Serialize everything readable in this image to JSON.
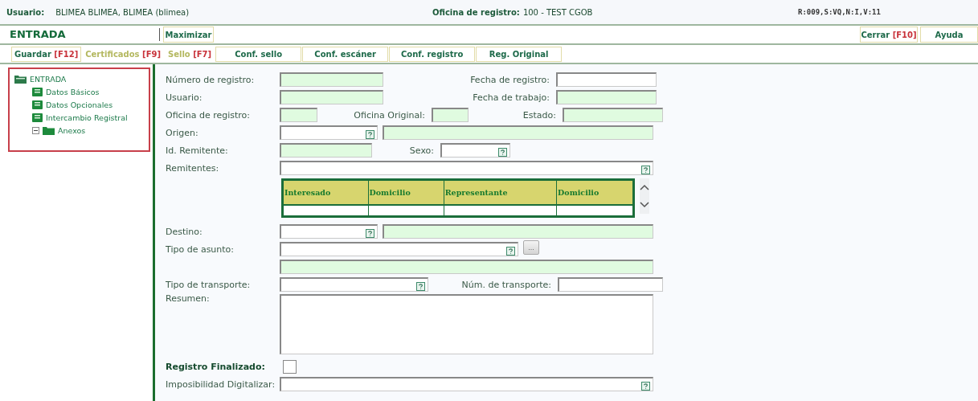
{
  "header": {
    "user_label": "Usuario:",
    "user": "BLIMEA BLIMEA, BLIMEA (blimea)",
    "office_label": "Oficina de registro:",
    "office": "100 - TEST CGOB",
    "version": "R:009,S:VQ,N:I,V:11"
  },
  "title": "ENTRADA",
  "maximize_button": "Maximizar",
  "right_buttons": [
    {
      "label": "Cerrar",
      "key": "[F10]"
    },
    {
      "label": "Ayuda"
    }
  ],
  "action_buttons": [
    {
      "label": "Guardar",
      "key": "[F12]",
      "disabled": false
    },
    {
      "label": "Certificados",
      "key": "[F9]",
      "disabled": true
    },
    {
      "label": "Sello",
      "key": "[F7]",
      "disabled": true
    },
    {
      "label": "Conf. sello",
      "disabled": false
    },
    {
      "label": "Conf. escáner",
      "disabled": false
    },
    {
      "label": "Conf. registro",
      "disabled": false
    },
    {
      "label": "Reg. Original",
      "disabled": false
    }
  ],
  "tree": {
    "label": "ENTRADA",
    "children": [
      {
        "label": "Datos Básicos"
      },
      {
        "label": "Datos Opcionales"
      },
      {
        "label": "Intercambio Registral"
      },
      {
        "label": "Anexos",
        "expanded": true
      }
    ]
  },
  "form_rows": [
    {
      "label": "Número de registro:",
      "items": [
        {
          "kind": "input",
          "readonly": true
        },
        {
          "kind": "label",
          "text": "Fecha de registro:"
        },
        {
          "kind": "input",
          "readonly": false
        }
      ]
    },
    {
      "label": "Usuario:",
      "items": [
        {
          "kind": "input",
          "readonly": true
        },
        {
          "kind": "label",
          "text": "Fecha de trabajo:"
        },
        {
          "kind": "input",
          "readonly": true
        }
      ]
    },
    {
      "label": "Oficina de registro:",
      "items": [
        {
          "kind": "input",
          "readonly": true
        },
        {
          "kind": "label",
          "text": "Oficina Original:"
        },
        {
          "kind": "input",
          "readonly": true
        },
        {
          "kind": "label",
          "text": "Estado:"
        },
        {
          "kind": "input",
          "readonly": true
        }
      ]
    },
    {
      "label": "Origen:",
      "items": [
        {
          "kind": "lookup",
          "readonly": false
        },
        {
          "kind": "input",
          "readonly": true
        }
      ]
    },
    {
      "label": "Id. Remitente:",
      "items": [
        {
          "kind": "input",
          "readonly": true
        },
        {
          "kind": "label",
          "text": "Sexo:"
        },
        {
          "kind": "lookup",
          "readonly": false
        }
      ]
    },
    {
      "label": "Remitentes:",
      "items": [
        {
          "kind": "lookup",
          "readonly": false
        }
      ]
    },
    {
      "kind": "table",
      "columns": [
        "Interesado",
        "Domicilio",
        "Representante",
        "Domicilio"
      ]
    },
    {
      "label": "Destino:",
      "items": [
        {
          "kind": "lookup",
          "readonly": false
        },
        {
          "kind": "input",
          "readonly": true
        }
      ]
    },
    {
      "label": "Tipo de asunto:",
      "items": [
        {
          "kind": "lookup",
          "readonly": false
        },
        {
          "kind": "button",
          "text": "..."
        }
      ]
    },
    {
      "items": [
        {
          "kind": "input",
          "readonly": true
        }
      ]
    },
    {
      "label": "Tipo de transporte:",
      "items": [
        {
          "kind": "lookup",
          "readonly": false
        },
        {
          "kind": "label",
          "text": "Núm. de transporte:"
        },
        {
          "kind": "input",
          "readonly": false
        }
      ]
    },
    {
      "label": "Resumen:",
      "items": [
        {
          "kind": "textarea",
          "readonly": false
        }
      ]
    },
    {
      "label": "Registro Finalizado:",
      "strong": true,
      "items": [
        {
          "kind": "checkbox",
          "checked": false
        }
      ]
    },
    {
      "label": "Imposibilidad Digitalizar:",
      "items": [
        {
          "kind": "lookup",
          "readonly": false
        }
      ]
    }
  ]
}
